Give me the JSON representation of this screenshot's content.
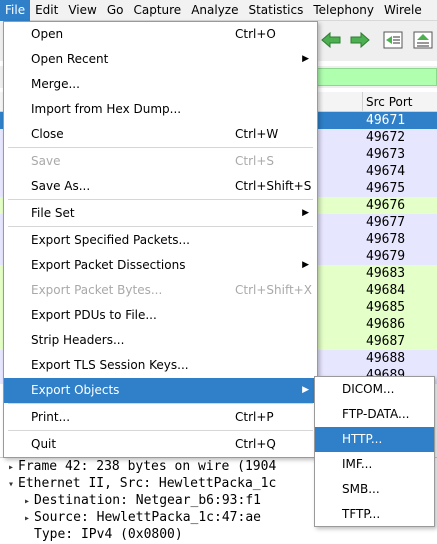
{
  "menubar": {
    "items": [
      "File",
      "Edit",
      "View",
      "Go",
      "Capture",
      "Analyze",
      "Statistics",
      "Telephony",
      "Wirele"
    ]
  },
  "packet_list": {
    "column_header": "Src Port",
    "rows": [
      {
        "port": "49671",
        "bg": "#2f80c9",
        "fg": "#ffffff"
      },
      {
        "port": "49672",
        "bg": "#e7e6ff"
      },
      {
        "port": "49673",
        "bg": "#e7e6ff"
      },
      {
        "port": "49674",
        "bg": "#e7e6ff"
      },
      {
        "port": "49675",
        "bg": "#e7e6ff"
      },
      {
        "port": "49676",
        "bg": "#e4ffc7"
      },
      {
        "port": "49677",
        "bg": "#e7e6ff"
      },
      {
        "port": "49678",
        "bg": "#e7e6ff"
      },
      {
        "port": "49679",
        "bg": "#e7e6ff"
      },
      {
        "port": "49683",
        "bg": "#e4ffc7"
      },
      {
        "port": "49684",
        "bg": "#e4ffc7"
      },
      {
        "port": "49685",
        "bg": "#e4ffc7"
      },
      {
        "port": "49686",
        "bg": "#e4ffc7"
      },
      {
        "port": "49687",
        "bg": "#e4ffc7"
      },
      {
        "port": "49688",
        "bg": "#e7e6ff"
      },
      {
        "port": "49689",
        "bg": "#e7e6ff"
      }
    ]
  },
  "file_menu": {
    "items": [
      {
        "label": "Open",
        "shortcut": "Ctrl+O"
      },
      {
        "label": "Open Recent",
        "submenu": true
      },
      {
        "label": "Merge..."
      },
      {
        "label": "Import from Hex Dump..."
      },
      {
        "label": "Close",
        "shortcut": "Ctrl+W"
      },
      {
        "label": "Save",
        "shortcut": "Ctrl+S",
        "disabled": true
      },
      {
        "label": "Save As...",
        "shortcut": "Ctrl+Shift+S"
      },
      {
        "label": "File Set",
        "submenu": true
      },
      {
        "label": "Export Specified Packets..."
      },
      {
        "label": "Export Packet Dissections",
        "submenu": true
      },
      {
        "label": "Export Packet Bytes...",
        "shortcut": "Ctrl+Shift+X",
        "disabled": true
      },
      {
        "label": "Export PDUs to File..."
      },
      {
        "label": "Strip Headers..."
      },
      {
        "label": "Export TLS Session Keys..."
      },
      {
        "label": "Export Objects",
        "submenu": true,
        "selected": true
      },
      {
        "label": "Print...",
        "shortcut": "Ctrl+P"
      },
      {
        "label": "Quit",
        "shortcut": "Ctrl+Q"
      }
    ]
  },
  "export_objects_submenu": {
    "items": [
      {
        "label": "DICOM..."
      },
      {
        "label": "FTP-DATA..."
      },
      {
        "label": "HTTP...",
        "selected": true
      },
      {
        "label": "IMF..."
      },
      {
        "label": "SMB..."
      },
      {
        "label": "TFTP..."
      }
    ]
  },
  "details": {
    "lines": [
      {
        "text": "Frame 42: 238 bytes on wire (1904",
        "expanded": false
      },
      {
        "text": "Ethernet II, Src: HewlettPacka_1c",
        "expanded": true
      },
      {
        "text": "Destination: Netgear_b6:93:f1",
        "expanded": false
      },
      {
        "text": "Source: HewlettPacka_1c:47:ae",
        "expanded": false
      },
      {
        "text": "Type: IPv4 (0x0800)",
        "expanded": null
      }
    ]
  },
  "colors": {
    "accent": "#2f80c9",
    "tcp_row": "#e7e6ff",
    "http_row": "#e4ffc7",
    "filter_ok": "#afffaf"
  }
}
